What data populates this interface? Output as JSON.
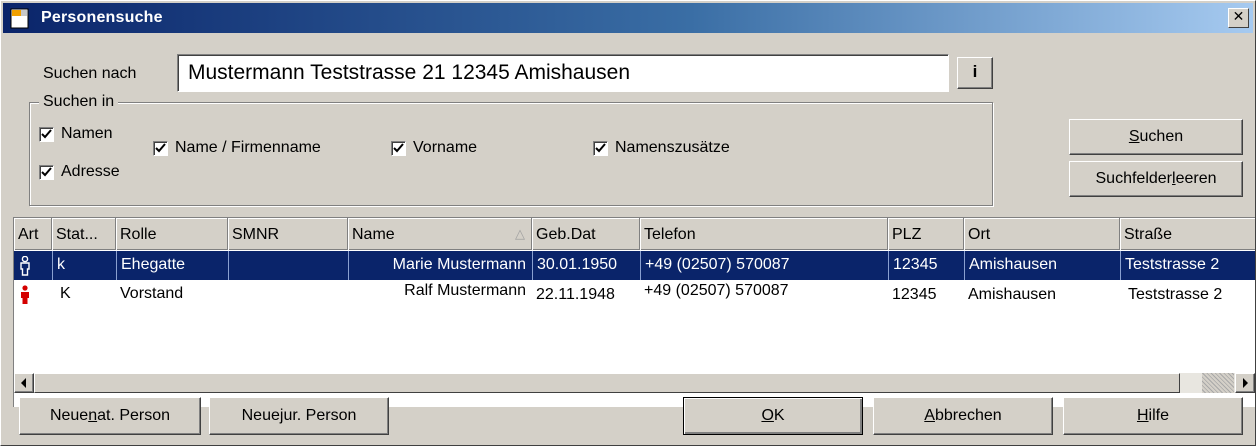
{
  "window": {
    "title": "Personensuche",
    "close_glyph": "✕"
  },
  "search": {
    "label": "Suchen nach",
    "value": "Mustermann Teststrasse 21 12345 Amishausen",
    "info_label": "i"
  },
  "search_in": {
    "legend": "Suchen in",
    "checkboxes": {
      "namen": {
        "label": "Namen",
        "checked": true
      },
      "adresse": {
        "label": "Adresse",
        "checked": true
      },
      "name_firma": {
        "label": "Name / Firmenname",
        "checked": true
      },
      "vorname": {
        "label": "Vorname",
        "checked": true
      },
      "namenszusaetze": {
        "label": "Namenszusätze",
        "checked": true
      }
    }
  },
  "buttons": {
    "suchen": {
      "pre": "",
      "key": "S",
      "post": "uchen"
    },
    "leeren": {
      "pre": "Suchfelder ",
      "key": "l",
      "post": "eeren"
    },
    "neue_nat": {
      "pre": "Neue ",
      "key": "n",
      "post": "at. Person"
    },
    "neue_jur": {
      "pre": "Neue ",
      "key": "j",
      "post": "ur. Person"
    },
    "ok": {
      "pre": "",
      "key": "O",
      "post": "K"
    },
    "abbrechen": {
      "pre": "",
      "key": "A",
      "post": "bbrechen"
    },
    "hilfe": {
      "pre": "",
      "key": "H",
      "post": "ilfe"
    }
  },
  "table": {
    "columns": {
      "art": "Art",
      "status": "Stat...",
      "rolle": "Rolle",
      "smnr": "SMNR",
      "name": "Name",
      "gebdat": "Geb.Dat",
      "telefon": "Telefon",
      "plz": "PLZ",
      "ort": "Ort",
      "strasse": "Straße"
    },
    "sort_indicator": "△",
    "rows": [
      {
        "art_icon": "person-icon",
        "status": "k",
        "rolle": "Ehegatte",
        "smnr": "",
        "name": "Marie Mustermann",
        "gebdat": "30.01.1950",
        "telefon": "+49 (02507) 570087",
        "plz": "12345",
        "ort": "Amishausen",
        "strasse": "Teststrasse 2",
        "selected": true
      },
      {
        "art_icon": "person-icon",
        "status": "K",
        "rolle": "Vorstand",
        "smnr": "",
        "name": "Ralf Mustermann",
        "gebdat": "22.11.1948",
        "telefon": "+49 (02507) 570087",
        "plz": "12345",
        "ort": "Amishausen",
        "strasse": "Teststrasse 2",
        "selected": false
      }
    ]
  },
  "colors": {
    "selection": "#0a246a",
    "face": "#d4d0c8",
    "person_selected": "#ffffff",
    "person_unselected": "#d40000"
  }
}
